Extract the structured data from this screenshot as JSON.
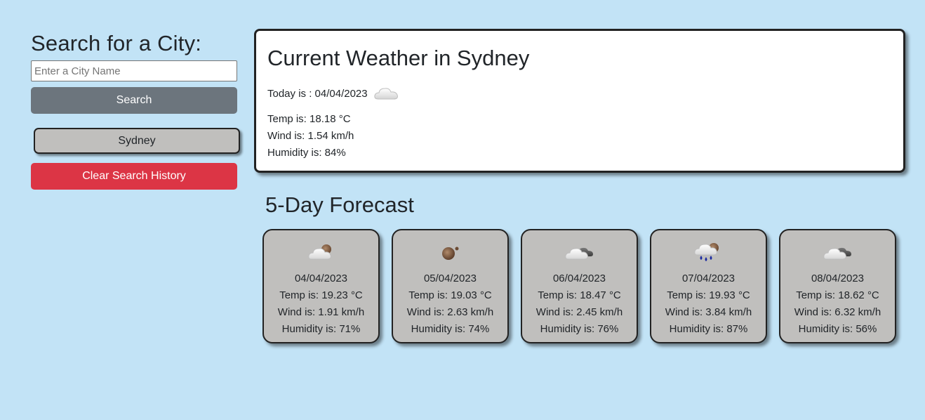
{
  "sidebar": {
    "title": "Search for a City:",
    "search_input": {
      "placeholder": "Enter a City Name",
      "value": ""
    },
    "search_button": "Search",
    "history": [
      "Sydney"
    ],
    "clear_button": "Clear Search History"
  },
  "current": {
    "title": "Current Weather in Sydney",
    "today": "Today is : 04/04/2023",
    "icon": "cloud-icon",
    "temp": "Temp is: 18.18 °C",
    "wind": "Wind is: 1.54 km/h",
    "humidity": "Humidity is: 84%"
  },
  "forecast": {
    "title": "5-Day Forecast",
    "days": [
      {
        "icon": "partly-cloudy-icon",
        "date": "04/04/2023",
        "temp": "Temp is: 19.23 °C",
        "wind": "Wind is: 1.91 km/h",
        "humidity": "Humidity is: 71%"
      },
      {
        "icon": "night-clear-icon",
        "date": "05/04/2023",
        "temp": "Temp is: 19.03 °C",
        "wind": "Wind is: 2.63 km/h",
        "humidity": "Humidity is: 74%"
      },
      {
        "icon": "broken-clouds-icon",
        "date": "06/04/2023",
        "temp": "Temp is: 18.47 °C",
        "wind": "Wind is: 2.45 km/h",
        "humidity": "Humidity is: 76%"
      },
      {
        "icon": "rain-icon",
        "date": "07/04/2023",
        "temp": "Temp is: 19.93 °C",
        "wind": "Wind is: 3.84 km/h",
        "humidity": "Humidity is: 87%"
      },
      {
        "icon": "broken-clouds-icon",
        "date": "08/04/2023",
        "temp": "Temp is: 18.62 °C",
        "wind": "Wind is: 6.32 km/h",
        "humidity": "Humidity is: 56%"
      }
    ]
  },
  "colors": {
    "page_bg": "#c2e3f6",
    "search_button": "#6c757d",
    "clear_button": "#dc3545",
    "card_gray": "#c0bfbd"
  }
}
